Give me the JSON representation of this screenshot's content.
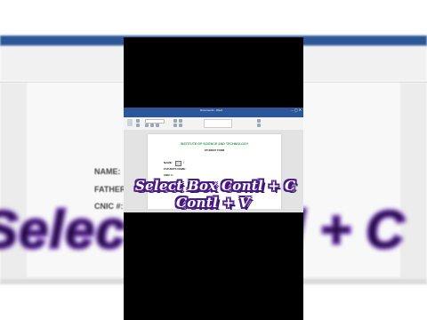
{
  "background": {
    "labels": [
      {
        "text": "NAME:"
      },
      {
        "text": "FATHER'S"
      },
      {
        "text": "CNIC #:"
      }
    ],
    "big_caption_left": "Select",
    "big_caption_right": "d + C"
  },
  "word": {
    "window_title": "Document1 - Word",
    "window_buttons": "–  ▢  ✕",
    "menu_tabs": [
      "File",
      "Home",
      "Insert",
      "Design",
      "Layout",
      "References",
      "Mailings",
      "Review",
      "View"
    ],
    "document": {
      "institute": "INSTITUTE OF SCIENCE AND TECHNOLOGY",
      "form_title": "STUDENT FORM",
      "fields": [
        {
          "label": "NAME:"
        },
        {
          "label": "FATHER'S NAME:"
        },
        {
          "label": "CNIC #:"
        }
      ]
    }
  },
  "captions": {
    "line1": "Select Box Contl + C",
    "line2": "Contl + V"
  },
  "colors": {
    "word_blue": "#2b579a",
    "title_green": "#2e9d4e",
    "caption_outline": "#4a1b86"
  }
}
